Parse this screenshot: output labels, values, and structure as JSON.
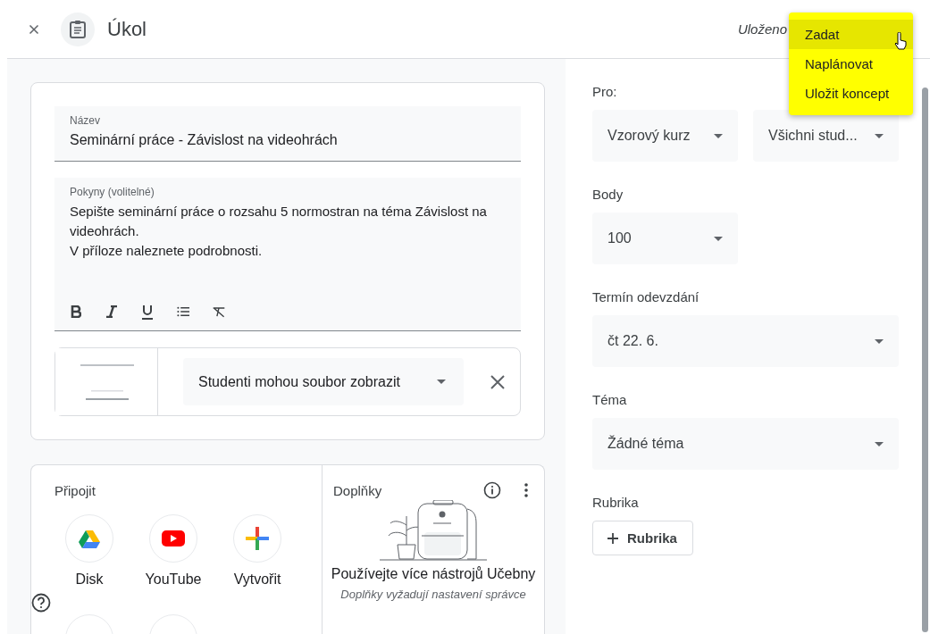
{
  "header": {
    "title": "Úkol",
    "status": "Uloženo"
  },
  "menu": {
    "items": [
      {
        "label": "Zadat",
        "selected": true
      },
      {
        "label": "Naplánovat",
        "selected": false
      },
      {
        "label": "Uložit koncept",
        "selected": false
      }
    ]
  },
  "form": {
    "title_field": {
      "label": "Název",
      "value": "Seminární práce - Závislost na videohrách"
    },
    "instructions": {
      "label": "Pokyny (volitelné)",
      "value": "Sepište seminární práce o rozsahu 5 normostran na téma Závislost na videohrách.\nV příloze naleznete podrobnosti."
    },
    "attachment": {
      "kind": "picture",
      "permission": "Studenti mohou soubor zobrazit"
    }
  },
  "connect": {
    "title": "Připojit",
    "items": [
      {
        "label": "Disk",
        "kind": "drive"
      },
      {
        "label": "YouTube",
        "kind": "youtube"
      },
      {
        "label": "Vytvořit",
        "kind": "create"
      }
    ]
  },
  "addons": {
    "title": "Doplňky",
    "headline": "Používejte více nástrojů Učebny",
    "note": "Doplňky vyžadují nastavení správce"
  },
  "side": {
    "for": {
      "label": "Pro:",
      "selects": [
        "Vzorový kurz",
        "Všichni stud..."
      ]
    },
    "points": {
      "label": "Body",
      "value": "100"
    },
    "due": {
      "label": "Termín odevzdání",
      "value": "čt 22. 6."
    },
    "topic": {
      "label": "Téma",
      "value": "Žádné téma"
    },
    "rubric": {
      "label": "Rubrika",
      "button": "Rubrika"
    }
  }
}
